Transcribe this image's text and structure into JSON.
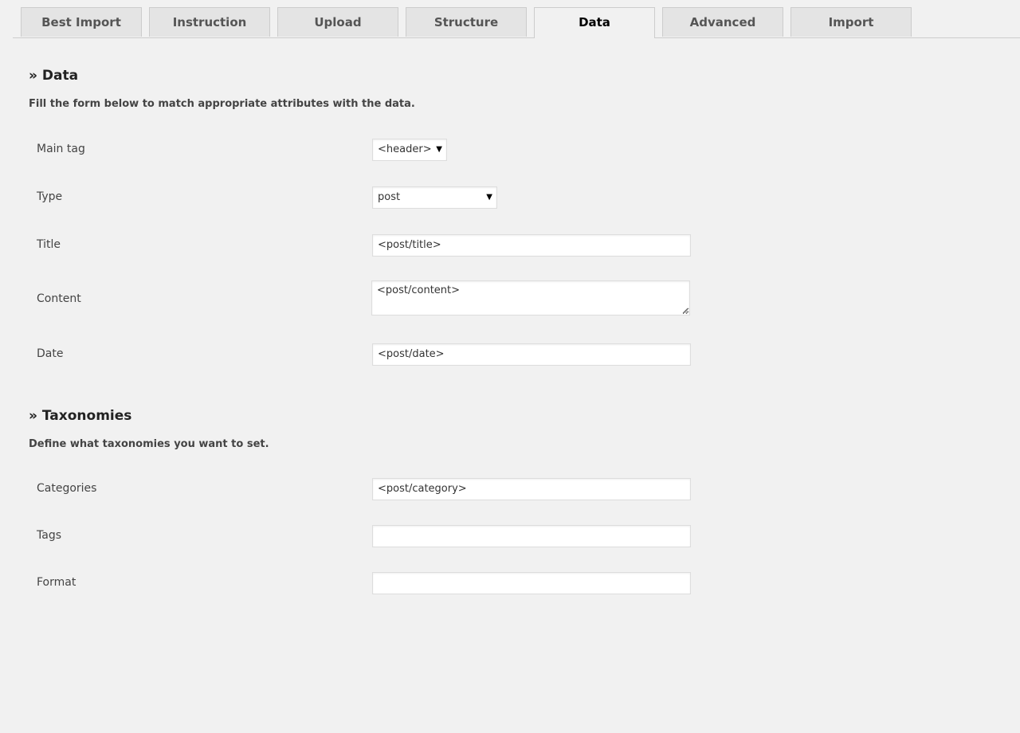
{
  "tabs": [
    {
      "label": "Best Import"
    },
    {
      "label": "Instruction"
    },
    {
      "label": "Upload"
    },
    {
      "label": "Structure"
    },
    {
      "label": "Data",
      "active": true
    },
    {
      "label": "Advanced"
    },
    {
      "label": "Import"
    }
  ],
  "data_section": {
    "title": "» Data",
    "description": "Fill the form below to match appropriate attributes with the data.",
    "fields": {
      "main_tag": {
        "label": "Main tag",
        "value": "<header>"
      },
      "type": {
        "label": "Type",
        "value": "post"
      },
      "title": {
        "label": "Title",
        "value": "<post/title>"
      },
      "content": {
        "label": "Content",
        "value": "<post/content>"
      },
      "date": {
        "label": "Date",
        "value": "<post/date>"
      }
    }
  },
  "taxonomies_section": {
    "title": "» Taxonomies",
    "description": "Define what taxonomies you want to set.",
    "fields": {
      "categories": {
        "label": "Categories",
        "value": "<post/category>"
      },
      "tags": {
        "label": "Tags",
        "value": ""
      },
      "format": {
        "label": "Format",
        "value": ""
      }
    }
  },
  "icons": {
    "select_caret": "caret-down-icon"
  }
}
